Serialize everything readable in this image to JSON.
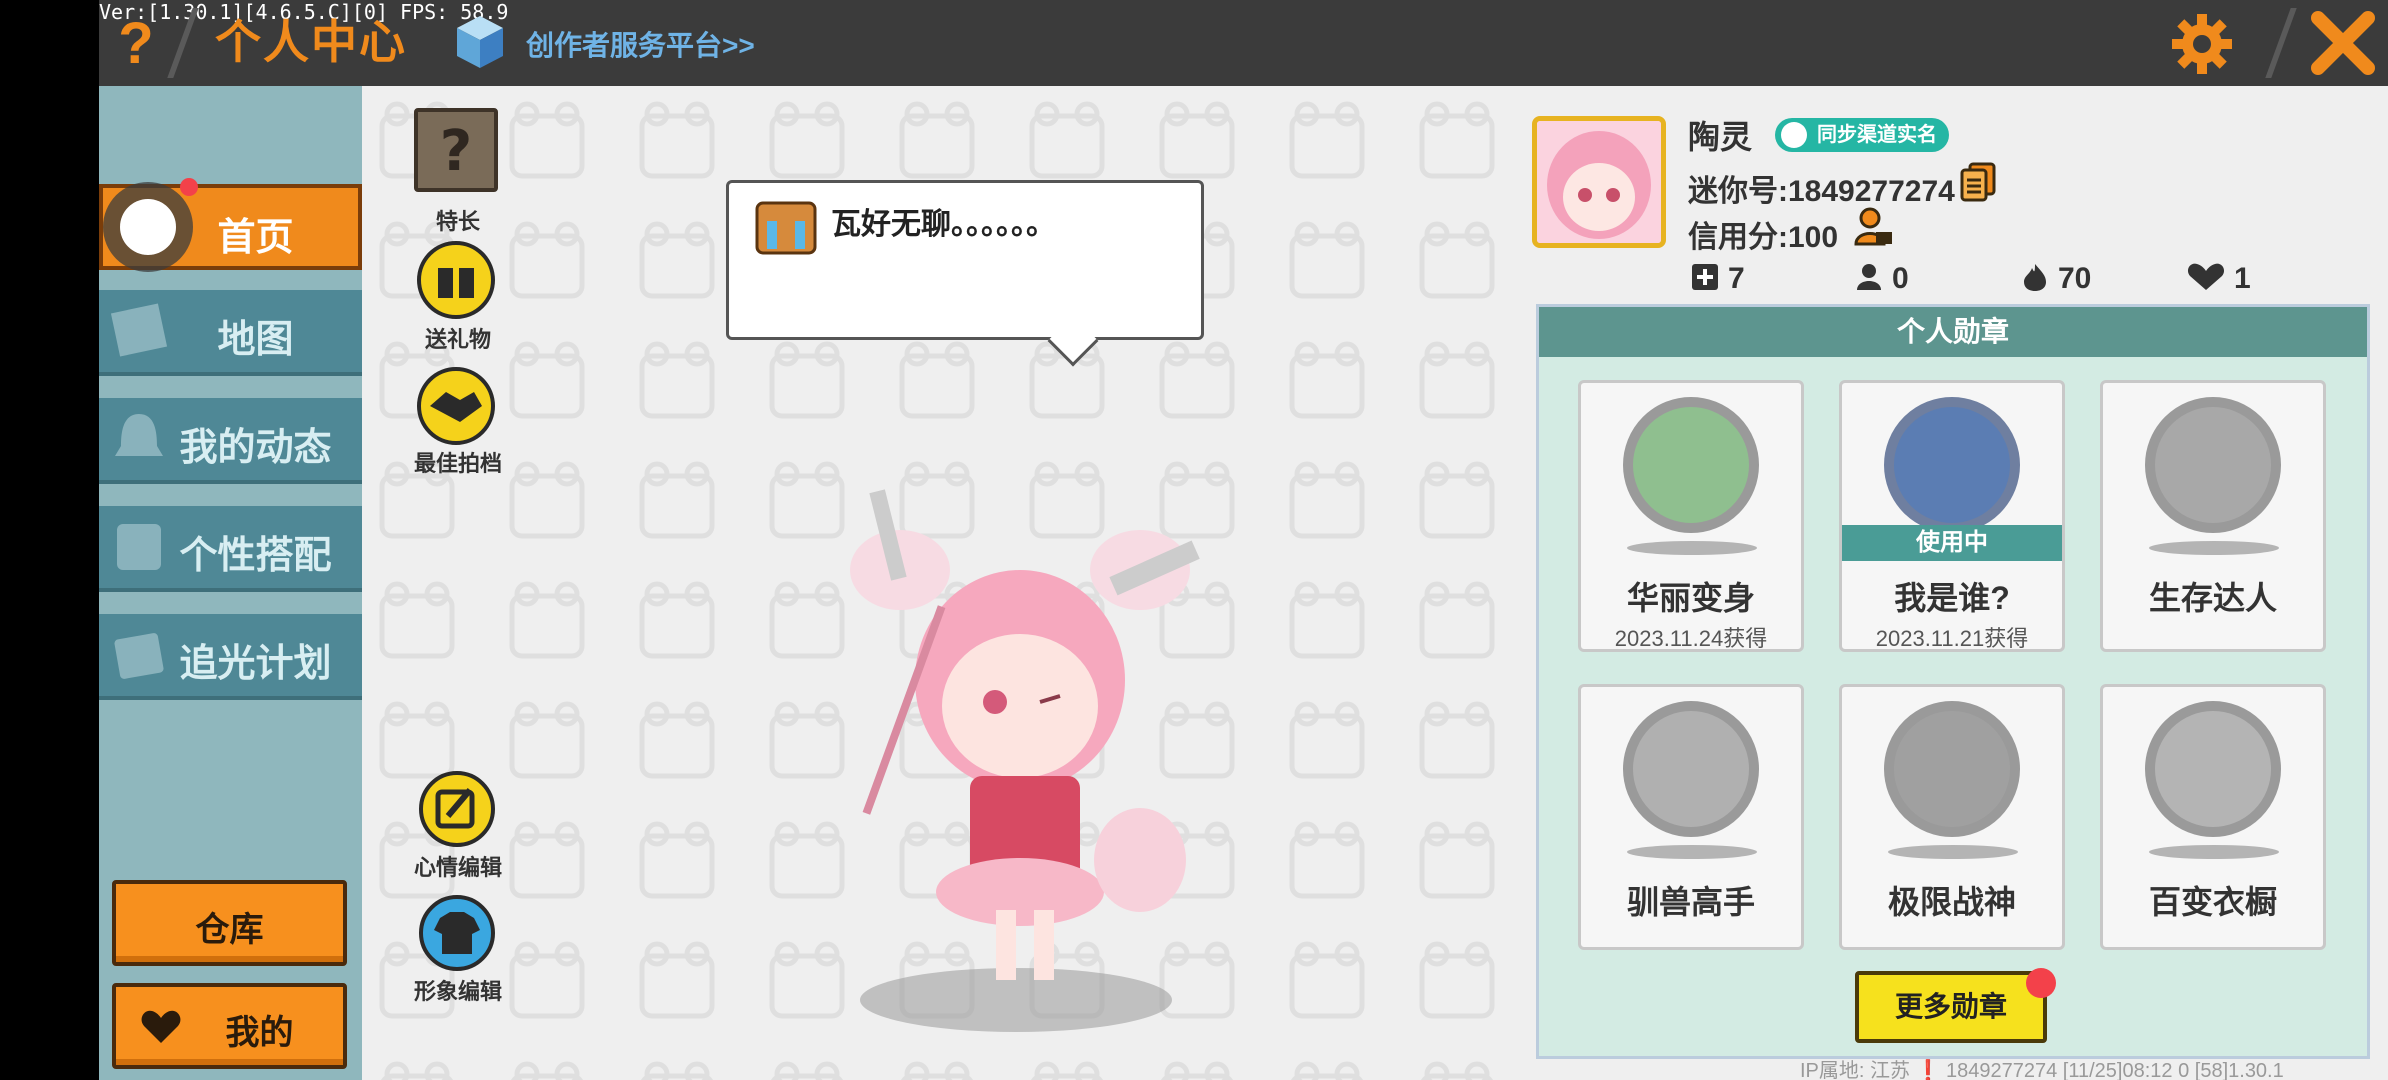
{
  "debug": {
    "version_text": "Ver:[1.30.1][4.6.5.C][0] FPS: 58.9"
  },
  "header": {
    "help_icon_glyph": "?",
    "title": "个人中心",
    "creator_link": "创作者服务平台>>",
    "accent": "#f08a1c"
  },
  "nav": {
    "items": [
      {
        "label": "首页",
        "icon": "home-icon",
        "active": true
      },
      {
        "label": "地图",
        "icon": "map-icon"
      },
      {
        "label": "我的动态",
        "icon": "bell-icon"
      },
      {
        "label": "个性搭配",
        "icon": "wardrobe-icon"
      },
      {
        "label": "追光计划",
        "icon": "crown-icon"
      }
    ],
    "warehouse_label": "仓库",
    "mine_label": "我的"
  },
  "side_actions": {
    "specialty": "特长",
    "gift": "送礼物",
    "best_photo": "最佳拍档",
    "mood_edit": "心情编辑",
    "avatar_edit": "形象编辑"
  },
  "speech": {
    "text": "瓦好无聊。。。。。。"
  },
  "profile": {
    "name": "陶灵",
    "sync_badge": "同步渠道实名",
    "mini_id": "迷你号:1849277274",
    "credit": "信用分:100",
    "stats": [
      {
        "icon": "plus-square-icon",
        "value": "7"
      },
      {
        "icon": "fans-icon",
        "value": "0"
      },
      {
        "icon": "fire-icon",
        "value": "70"
      },
      {
        "icon": "heart-icon",
        "value": "1"
      }
    ]
  },
  "medals": {
    "header": "个人勋章",
    "items": [
      {
        "name": "华丽变身",
        "date": "2023.11.24获得",
        "color": "#8fbf8f"
      },
      {
        "name": "我是谁?",
        "date": "2023.11.21获得",
        "in_use": "使用中",
        "color": "#5b7db3"
      },
      {
        "name": "生存达人",
        "color": "#a8a8a8"
      },
      {
        "name": "驯兽高手",
        "color": "#b0b0b0"
      },
      {
        "name": "极限战神",
        "color": "#a0a0a0"
      },
      {
        "name": "百变衣橱",
        "color": "#b4b4b4"
      }
    ],
    "more_label": "更多勋章"
  },
  "footer": {
    "text": "IP属地: 江苏 ❗   1849277274   [11/25]08:12 0   [58]1.30.1"
  }
}
